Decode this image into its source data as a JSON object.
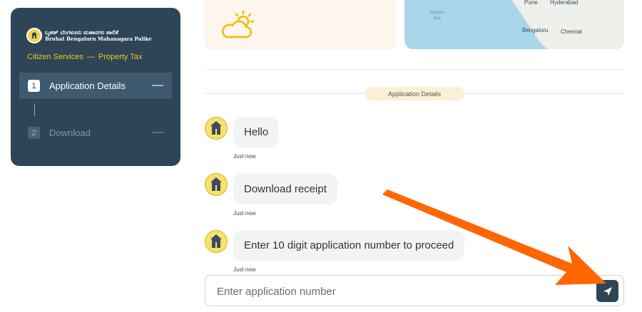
{
  "sidebar": {
    "logo": {
      "kannada": "ಬೃಹತ್ ಬೆಂಗಳೂರು ಮಹಾನಗರ ಪಾಲಿಕೆ",
      "english": "Bruhat Bengaluru Mahanagara Palike"
    },
    "breadcrumb": {
      "first": "Citizen Services",
      "separator": "—",
      "second": "Property Tax"
    },
    "steps": [
      {
        "number": "1",
        "label": "Application Details",
        "toggle": "—"
      },
      {
        "number": "2",
        "label": "Download",
        "toggle": "—"
      }
    ]
  },
  "map": {
    "labels": {
      "sea": "Arabian\nSea",
      "pune": "Pune",
      "hyderabad": "Hyderabad",
      "bengaluru": "Bengaluru",
      "chennai": "Chennai"
    }
  },
  "chat": {
    "section_label": "Application Details",
    "messages": [
      {
        "text": "Hello",
        "time": "Just now"
      },
      {
        "text": "Download receipt",
        "time": "Just now"
      },
      {
        "text": "Enter 10 digit application number to proceed",
        "time": "Just now"
      }
    ],
    "input": {
      "placeholder": "Enter application number",
      "value": ""
    }
  },
  "colors": {
    "sidebar_bg": "#2e4558",
    "accent_yellow": "#f5c518",
    "bubble_bg": "#f2f3f5",
    "annotation_orange": "#ff6600"
  },
  "icons": [
    "bbmp-emblem-icon",
    "weather-partly-sunny-icon",
    "send-icon",
    "bot-avatar-icon"
  ]
}
